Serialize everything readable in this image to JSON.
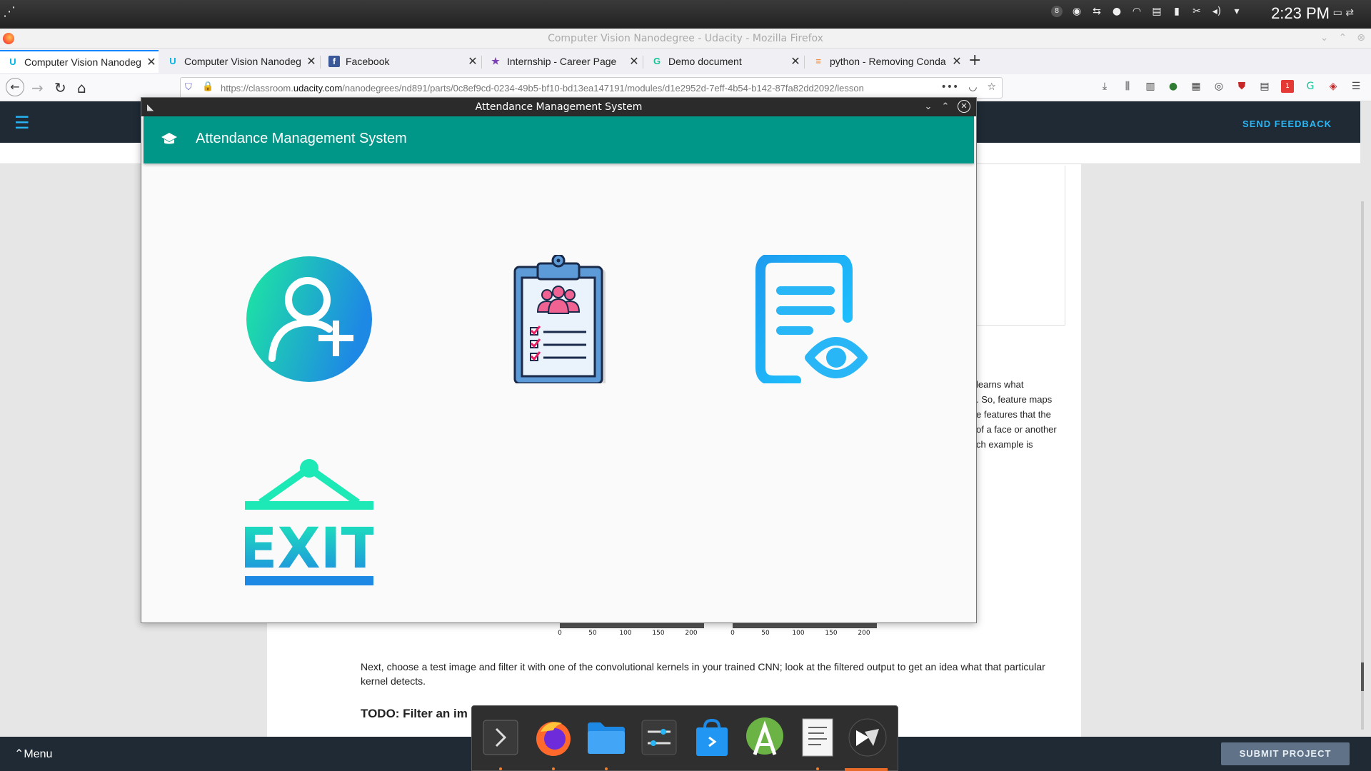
{
  "system": {
    "clock": "2:23 PM",
    "tray_badge": "8",
    "icons": [
      "badge-icon",
      "accessibility-icon",
      "network-icon",
      "bulb-icon",
      "wifi-icon",
      "clipboard-icon",
      "battery-icon",
      "tools-icon",
      "volume-icon",
      "dropdown-icon"
    ]
  },
  "browser": {
    "window_title": "Computer Vision Nanodegree - Udacity - Mozilla Firefox",
    "tabs": [
      {
        "label": "Computer Vision Nanodeg",
        "icon": "udacity-icon"
      },
      {
        "label": "Computer Vision Nanodeg",
        "icon": "udacity-icon"
      },
      {
        "label": "Facebook",
        "icon": "facebook-icon"
      },
      {
        "label": "Internship - Career Page",
        "icon": "star-icon"
      },
      {
        "label": "Demo document",
        "icon": "grammarly-icon"
      },
      {
        "label": "python - Removing Conda",
        "icon": "stackoverflow-icon"
      }
    ],
    "url_prefix": "https://classroom.",
    "url_domain": "udacity.com",
    "url_rest": "/nanodegrees/nd891/parts/0c8ef9cd-0234-49b5-bf10-bd13ea147191/modules/d1e2952d-7eff-4b54-b142-87fa82dd2092/lesson",
    "extension_badge": "1"
  },
  "udacity": {
    "send_feedback": "SEND FEEDBACK",
    "side_text": [
      "learns what",
      ". So, feature maps",
      "e features that the",
      "of a face or another",
      "ch example is"
    ],
    "paragraph": "Next, choose a test image and filter it with one of the convolutional kernels in your trained CNN; look at the filtered output to get an idea what that particular kernel detects.",
    "todo_heading": "TODO: Filter an im",
    "axis_ticks": [
      "0",
      "50",
      "100",
      "150",
      "200"
    ],
    "menu_label": "Menu",
    "submit_label": "SUBMIT PROJECT"
  },
  "app": {
    "window_title": "Attendance Management System",
    "toolbar_title": "Attendance Management System",
    "tiles": [
      {
        "name": "add-user",
        "icon": "add-user-icon"
      },
      {
        "name": "attendance",
        "icon": "clipboard-attendance-icon"
      },
      {
        "name": "view-records",
        "icon": "view-document-icon"
      },
      {
        "name": "exit",
        "icon": "exit-sign-icon",
        "text": "EXIT"
      }
    ],
    "colors": {
      "toolbar": "#009688",
      "gradient_start": "#1de9a0",
      "gradient_end": "#1e88e5",
      "view_icon": "#29b6f6"
    }
  },
  "dock": {
    "items": [
      "terminal-icon",
      "firefox-icon",
      "files-icon",
      "settings-icon",
      "store-icon",
      "android-studio-icon",
      "text-editor-icon",
      "kivy-icon"
    ]
  }
}
